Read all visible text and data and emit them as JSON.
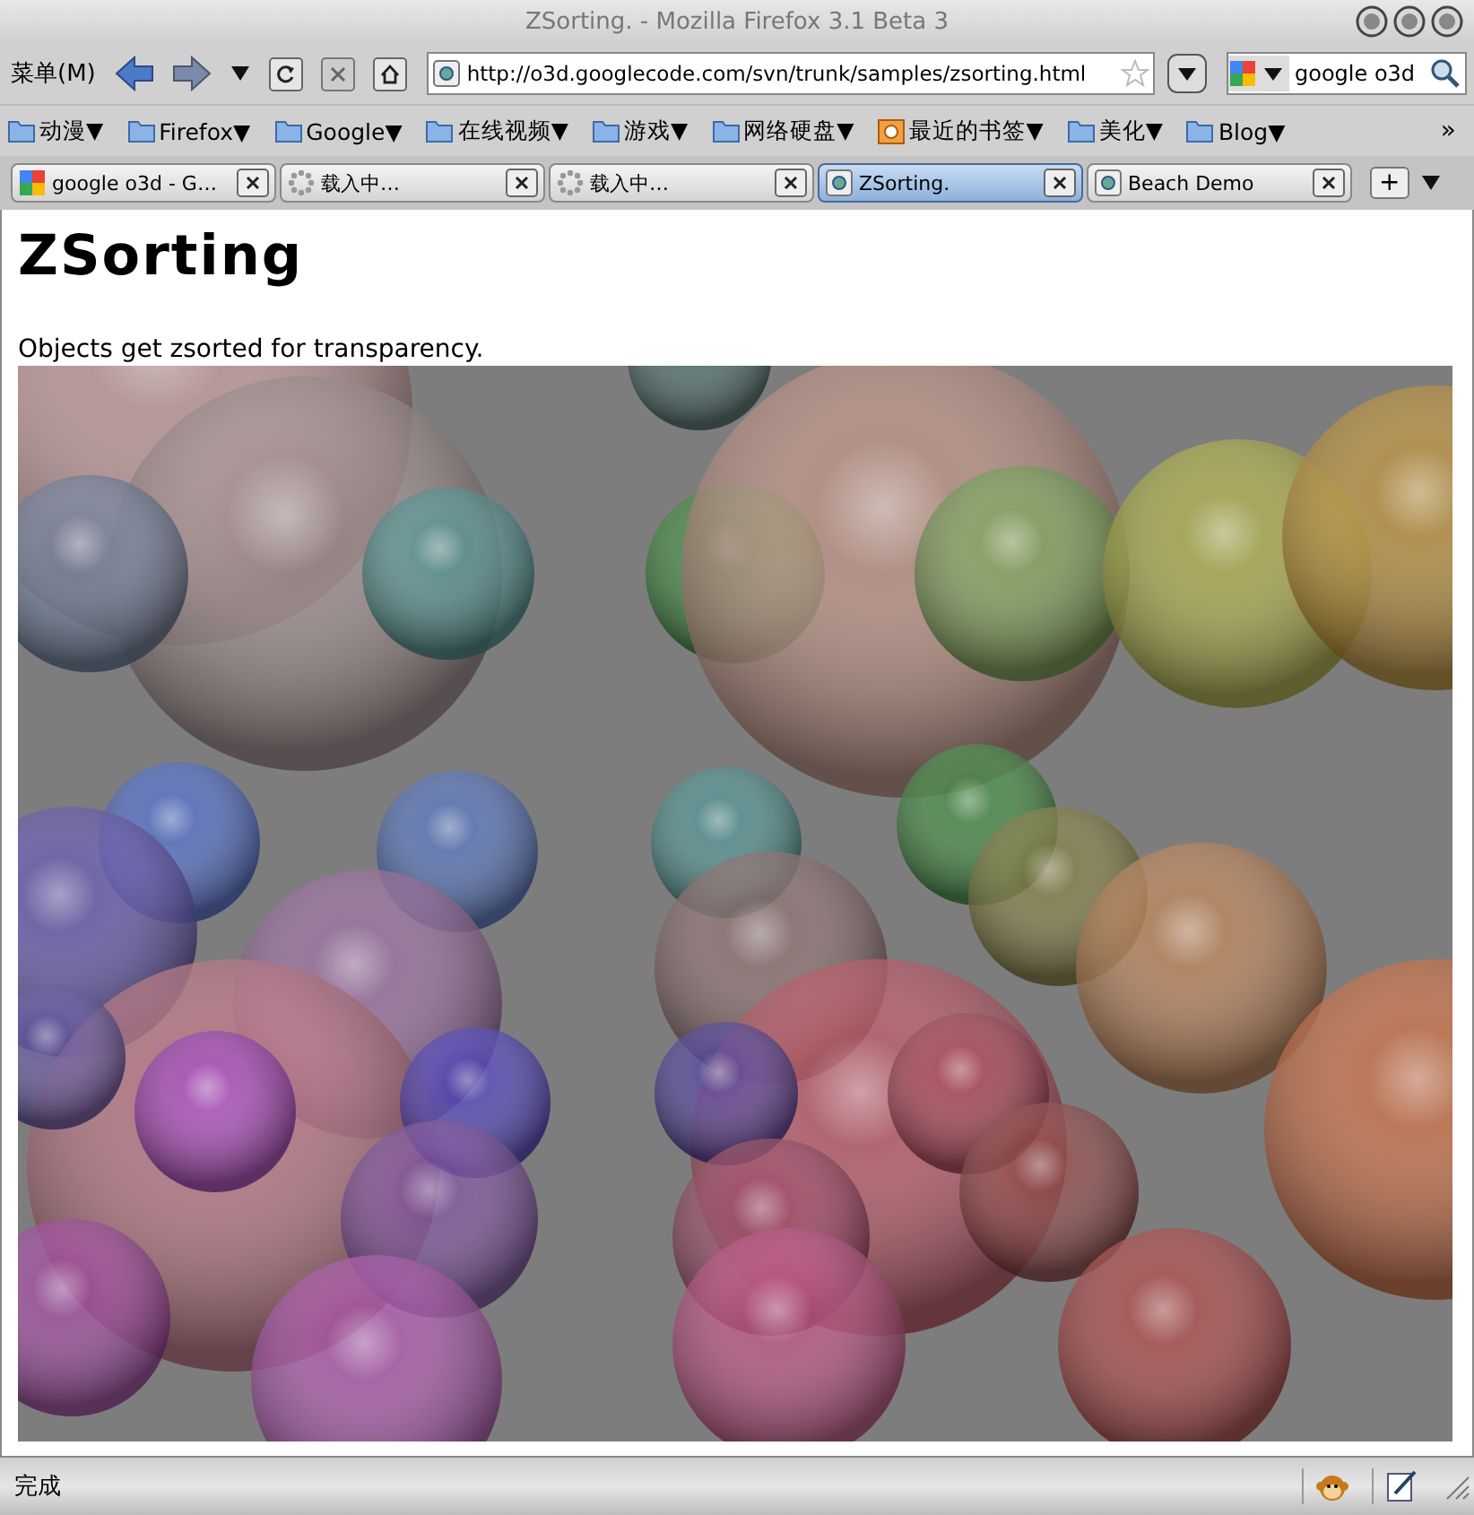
{
  "window": {
    "title": "ZSorting. - Mozilla Firefox 3.1 Beta 3"
  },
  "toolbar": {
    "menu_label": "菜单(M)",
    "address": "http://o3d.googlecode.com/svn/trunk/samples/zsorting.html",
    "search_value": "google o3d"
  },
  "bookmarks": [
    {
      "label": "动漫▼",
      "kind": "folder"
    },
    {
      "label": "Firefox▼",
      "kind": "folder"
    },
    {
      "label": "Google▼",
      "kind": "folder"
    },
    {
      "label": "在线视频▼",
      "kind": "folder"
    },
    {
      "label": "游戏▼",
      "kind": "folder"
    },
    {
      "label": "网络硬盘▼",
      "kind": "folder"
    },
    {
      "label": "最近的书签▼",
      "kind": "recent"
    },
    {
      "label": "美化▼",
      "kind": "folder"
    },
    {
      "label": "Blog▼",
      "kind": "folder"
    }
  ],
  "bookmarks_overflow": "»",
  "tabs": [
    {
      "label": "google o3d - G…",
      "kind": "google",
      "selected": false
    },
    {
      "label": "载入中…",
      "kind": "loading",
      "selected": false
    },
    {
      "label": "载入中…",
      "kind": "loading",
      "selected": false
    },
    {
      "label": "ZSorting.",
      "kind": "page",
      "selected": true
    },
    {
      "label": "Beach Demo",
      "kind": "page",
      "selected": false
    }
  ],
  "new_tab": "+",
  "page": {
    "heading": "ZSorting",
    "text": "Objects get zsorted for transparency."
  },
  "status_bar": {
    "text": "完成"
  }
}
